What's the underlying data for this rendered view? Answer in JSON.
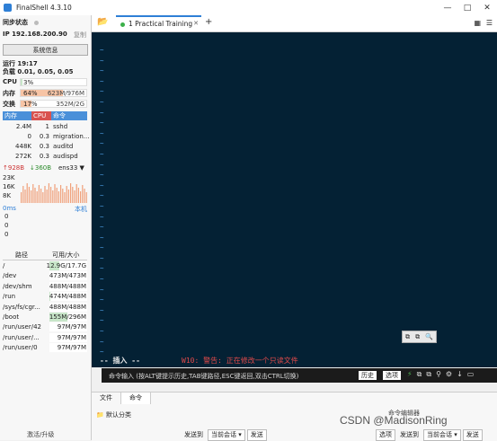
{
  "window": {
    "title": "FinalShell 4.3.10",
    "controls": [
      "—",
      "□",
      "✕"
    ]
  },
  "sidebar": {
    "sync_status": "同步状态",
    "ip": "IP  192.168.200.90",
    "copy": "复制",
    "sysinfo_button": "系统信息",
    "uptime": "运行 19:17",
    "load": "负载 0.01, 0.05, 0.05",
    "cpu": {
      "label": "CPU",
      "pct": "3%",
      "value": "",
      "percent": 3
    },
    "mem": {
      "label": "内存",
      "pct": "64%",
      "value": "623M/976M",
      "percent": 64
    },
    "swap": {
      "label": "交换",
      "pct": "17%",
      "value": "352M/2G",
      "percent": 17
    },
    "proc_headers": [
      "内存",
      "CPU",
      "命令"
    ],
    "processes": [
      {
        "mem": "2.4M",
        "cpu": "1",
        "cmd": "sshd"
      },
      {
        "mem": "0",
        "cpu": "0.3",
        "cmd": "migration..."
      },
      {
        "mem": "448K",
        "cpu": "0.3",
        "cmd": "auditd"
      },
      {
        "mem": "272K",
        "cpu": "0.3",
        "cmd": "audispd"
      }
    ],
    "net": {
      "up": "↑928B",
      "down": "↓360B",
      "iface": "ens33 ▼"
    },
    "net_scale": [
      "23K",
      "16K",
      "8K"
    ],
    "ping_label": "0ms",
    "local_label": "本机",
    "ping_values": [
      "0",
      "0",
      "0"
    ],
    "disk_headers": [
      "路径",
      "可用/大小"
    ],
    "disks": [
      {
        "path": "/",
        "size": "12.9G/17.7G",
        "used": 27
      },
      {
        "path": "/dev",
        "size": "473M/473M",
        "used": 0
      },
      {
        "path": "/dev/shm",
        "size": "488M/488M",
        "used": 0
      },
      {
        "path": "/run",
        "size": "474M/488M",
        "used": 3
      },
      {
        "path": "/sys/fs/cgr...",
        "size": "488M/488M",
        "used": 0
      },
      {
        "path": "/boot",
        "size": "155M/296M",
        "used": 48
      },
      {
        "path": "/run/user/42",
        "size": "97M/97M",
        "used": 0
      },
      {
        "path": "/run/user/...",
        "size": "97M/97M",
        "used": 0
      },
      {
        "path": "/run/user/0",
        "size": "97M/97M",
        "used": 0
      }
    ],
    "activate": "激活/升级"
  },
  "tabs": {
    "active": "1 Practical Training",
    "close": "✕",
    "add": "+"
  },
  "terminal": {
    "tilde_rows": 30,
    "mode": "-- 插入 --",
    "warning": "W10: 警告: 正在修改一个只读文件",
    "tools": [
      "⧉",
      "⧉",
      "🔍"
    ]
  },
  "command_bar": {
    "placeholder": "命令输入 (按ALT键提示历史,TAB键路径,ESC键返回,双击CTRL切换)",
    "history": "历史",
    "options": "选项"
  },
  "bottom": {
    "tabs": [
      "文件",
      "命令"
    ],
    "category": "默认分类",
    "editor": "命令编辑器",
    "watermark": "CSDN @MadisonRing",
    "send_to": "发送到",
    "current_session": "当前会话",
    "send": "发送",
    "options": "选项"
  },
  "colors": {
    "accent": "#2e7fd6",
    "terminal_bg": "#042134",
    "tilde": "#4c9be0",
    "warning": "#e04a4a",
    "mem_bar": "#f7c4a5",
    "swap_bar": "#f7c4a5",
    "cpu_bar": "#c8e6c9"
  }
}
